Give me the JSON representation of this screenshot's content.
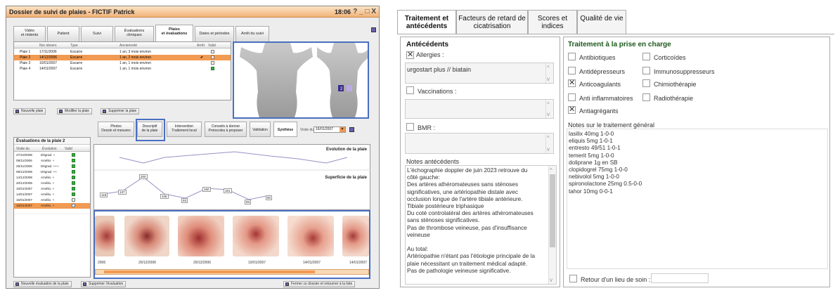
{
  "left_app": {
    "title": "Dossier de suivi de plaies - FICTIF Patrick",
    "time": "18:06",
    "window_controls": "? _ □ X",
    "tabs": [
      "Vidéo\net rédents",
      "Patient",
      "Suivi",
      "Évaluations\ncliniques",
      "Plaies\net évaluations",
      "Dates et périodes",
      "Arrêt du suivi"
    ],
    "grid_headers": [
      "Nro obvers",
      "Type",
      "Ancienneté",
      "Arrêt",
      "Valid"
    ],
    "wounds": [
      {
        "name": "Plaie 1",
        "date": "17/11/2006",
        "type": "Escarre",
        "age": "1 an, 3 mois environ"
      },
      {
        "name": "Plaie 2",
        "date": "14/12/2006",
        "type": "Escarre",
        "age": "1 an, 2 mois environ"
      },
      {
        "name": "Plaie 3",
        "date": "10/01/2007",
        "type": "Escarre",
        "age": "1 an, 1 mois environ"
      },
      {
        "name": "Plaie 4",
        "date": "14/01/2007",
        "type": "Escarre",
        "age": "1 an, 1 mois environ"
      }
    ],
    "btn_new_wound": "Nouvelle plaie",
    "btn_edit_wound": "Modifier la plaie",
    "btn_delete_wound": "Supprimer la plaie",
    "subtabs": [
      "Photos\nDessin et mesures",
      "Descriptif\nde la plaie",
      "Intervention\nTraitement local",
      "Conseils à donner\nProtocoles à proposer",
      "Validation",
      "Synthèse"
    ],
    "visit_label": "Visite du",
    "visit_date": "16/01/2007",
    "eval_title": "Évaluations de la plaie 2",
    "eval_headers": [
      "Visite du",
      "Évolution",
      "Valid"
    ],
    "evaluations": [
      {
        "date": "27/10/2006",
        "evo": "Dégrad. +"
      },
      {
        "date": "09/11/2006",
        "evo": "Amélio. +"
      },
      {
        "date": "25/11/2006",
        "evo": "Dégrad. +++"
      },
      {
        "date": "08/12/2006",
        "evo": "Dégrad. ++"
      },
      {
        "date": "14/12/2006",
        "evo": "Amélio. +"
      },
      {
        "date": "20/12/2006",
        "evo": "Amélio. +"
      },
      {
        "date": "10/01/2007",
        "evo": "Amélio. +"
      },
      {
        "date": "14/01/2007",
        "evo": "Amélio. +"
      },
      {
        "date": "15/01/2007",
        "evo": "Amélio. +"
      },
      {
        "date": "16/01/2007",
        "evo": "Amélio. +"
      }
    ],
    "chart_evolution_title": "Evolution de la plaie",
    "chart_surface_title": "Superficie de la plaie",
    "surface_labels": [
      "118",
      "137",
      "200",
      "108",
      "93",
      "160",
      "161",
      "93",
      "80"
    ],
    "photo_dates": [
      "2006",
      "20/12/2006",
      "20/12/2006",
      "10/01/2007",
      "14/01/2007",
      "14/01/2007"
    ],
    "btn_new_eval": "Nouvelle évaluation de la plaie",
    "btn_delete_eval": "Supprimer l'évaluation",
    "btn_close": "Fermer ce dossier et retourner à la liste"
  },
  "right_app": {
    "tabs": [
      "Traitement\net antécédents",
      "Facteurs de retard\nde cicatrisation",
      "Scores et\nindices",
      "Qualité\nde vie"
    ],
    "antecedents": {
      "title": "Antécédents",
      "allergies_label": "Allergies :",
      "allergies_checked": true,
      "allergies_text": "urgostart plus // biatain",
      "vaccinations_label": "Vaccinations :",
      "vaccinations_checked": false,
      "bmr_label": "BMR :",
      "bmr_checked": false,
      "notes_label": "Notes antécédents",
      "notes_text": "L'échographie doppler de juin 2023 retrouve du\ncôté gauche:\nDes artères athéromateuses sans sténoses\nsignificatives, une artériopathie distale avec\nocclusion longue de l'artère tibiale antérieure.\nTibiale postérieure triphasique\nDu coté controlatéral des artères athéromateuses\nsans sténoses significatives.\nPas de thrombose veineuse, pas d'insuffisance\nveineuse\n\nAu total:\n Artériopathie n'étant pas l'étiologie principale de la\nplaie nécessitant un traitement médical adapté.\nPas de pathologie veineuse significative."
    },
    "traitement": {
      "title": "Traitement à la prise en charge",
      "options_left": [
        {
          "label": "Antibiotiques",
          "checked": false
        },
        {
          "label": "Antidépresseurs",
          "checked": false
        },
        {
          "label": "Anticoagulants",
          "checked": true
        },
        {
          "label": "Anti inflammatoires",
          "checked": false
        },
        {
          "label": "Antiagrégants",
          "checked": true
        }
      ],
      "options_right": [
        {
          "label": "Corticoïdes",
          "checked": false
        },
        {
          "label": "Immunosuppresseurs",
          "checked": false
        },
        {
          "label": "Chimiothérapie",
          "checked": false
        },
        {
          "label": "Radiothérapie",
          "checked": false
        }
      ],
      "notes_label": "Notes sur le traitement général",
      "notes_text": "lasilix 40mg 1-0-0\neliquis 5mg 1-0-1\nentresto 49/51 1-0-1\ntemerit 5mg 1-0-0\ndoliprane 1g en SB\nclopidogrel 75mg 1-0-0\nnebivolol 5mg 1-0-0\nspironolactone 25mg 0.5-0-0\ntahor 10mg 0-0-1",
      "return_label": "Retour d'un lieu de soin :"
    }
  },
  "colors": {
    "selection": "#f19a52",
    "highlight_border": "#4a6fc2",
    "section_green": "#1d5a1d",
    "title_orange": "#f2b37b"
  }
}
